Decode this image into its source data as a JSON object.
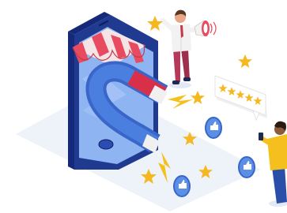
{
  "scene": {
    "colors": {
      "phone_body": "#1f3a8f",
      "screen": "#8fb4f2",
      "awning_red": "#e84a5f",
      "magnet_red": "#d9304a",
      "magnet_blue": "#4a7fe0",
      "star_gold": "#f5b820",
      "like_blue": "#5b8fe6",
      "shadow": "#e9eef7",
      "figure_shirt": "#f2f2f2",
      "figure_pants": "#b53a5a",
      "woman_shirt": "#f5c01e",
      "woman_pants": "#2b4fa8"
    },
    "icons": [
      "smartphone-icon",
      "shop-awning-icon",
      "magnet-icon",
      "megaphone-icon",
      "star-icon",
      "rating-card-icon",
      "thumbs-up-icon",
      "lightning-spark-icon"
    ],
    "rating_stars": 5
  }
}
